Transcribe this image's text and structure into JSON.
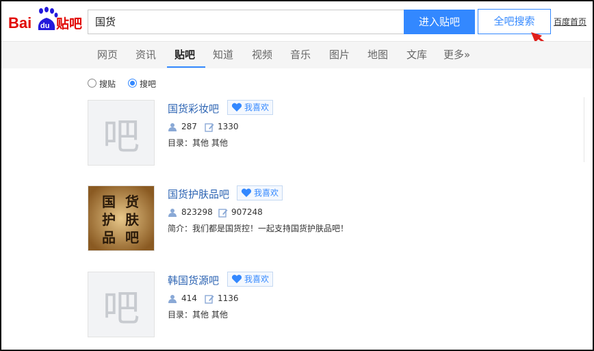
{
  "header": {
    "logo_text": {
      "bai": "Bai",
      "du": "du",
      "tieba": "贴吧"
    },
    "search_value": "国货",
    "enter_button": "进入贴吧",
    "search_all_button": "全吧搜索",
    "home_link": "百度首页"
  },
  "nav": {
    "items": [
      "网页",
      "资讯",
      "贴吧",
      "知道",
      "视频",
      "音乐",
      "图片",
      "地图",
      "文库",
      "更多»"
    ],
    "active_index": 2
  },
  "search_mode": {
    "options": [
      "搜贴",
      "搜吧"
    ],
    "selected": "搜吧"
  },
  "results": [
    {
      "title": "国货彩妆吧",
      "like_label": "我喜欢",
      "members": "287",
      "posts": "1330",
      "desc": "目录：其他  其他",
      "thumb_char": "吧",
      "has_image": false
    },
    {
      "title": "国货护肤品吧",
      "like_label": "我喜欢",
      "members": "823298",
      "posts": "907248",
      "desc": "简介：我们都是国货控！一起支持国货护肤品吧！",
      "thumb_image_text": [
        "国",
        "货",
        "护",
        "肤",
        "品",
        "吧"
      ],
      "has_image": true
    },
    {
      "title": "韩国货源吧",
      "like_label": "我喜欢",
      "members": "414",
      "posts": "1136",
      "desc": "目录：其他  其他",
      "thumb_char": "吧",
      "has_image": false
    }
  ],
  "colors": {
    "accent": "#3388ff",
    "link": "#2d64b3",
    "logo_red": "#e10601",
    "logo_blue": "#2319dc",
    "annotation_arrow": "#e0201c"
  }
}
